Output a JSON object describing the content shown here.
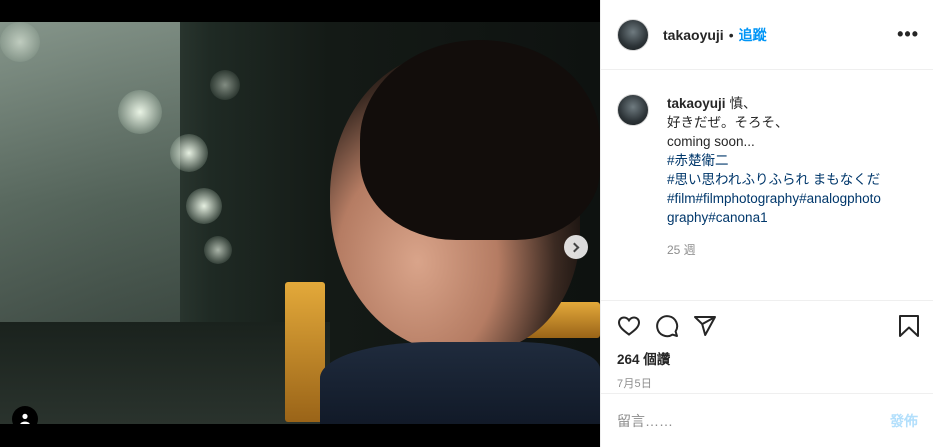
{
  "post": {
    "username": "takaoyuji",
    "separator": "•",
    "follow_label": "追蹤",
    "more_icon": "more-options-icon",
    "carousel": {
      "slide_count": 2,
      "active_index": 0
    }
  },
  "caption": {
    "username": "takaoyuji",
    "first_line": "慎、",
    "lines": [
      "好きだぜ。そろそ、",
      "coming soon..."
    ],
    "tags_lines": [
      "#赤楚衛二",
      "#思い思われふりふられ まもなくだ",
      "#film#filmphotography#analogphoto",
      "graphy#canona1"
    ],
    "time": "25 週"
  },
  "actions": {
    "likes": "264 個讚",
    "date": "7月5日",
    "icons": [
      "heart-icon",
      "comment-icon",
      "share-icon",
      "bookmark-icon"
    ]
  },
  "comment": {
    "placeholder": "留言……",
    "post_label": "發佈"
  },
  "colors": {
    "link": "#00376b",
    "follow": "#0095f6",
    "post_disabled": "#b2dffc",
    "muted": "#8e8e8e"
  }
}
